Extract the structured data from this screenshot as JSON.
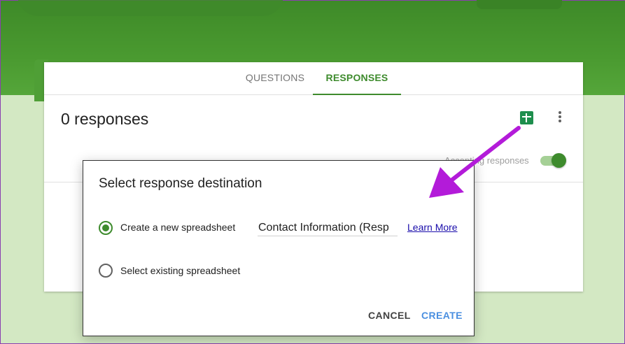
{
  "tabs": [
    {
      "label": "QUESTIONS",
      "active": false
    },
    {
      "label": "RESPONSES",
      "active": true
    }
  ],
  "responses": {
    "count_text": "0 responses",
    "accepting_label": "Accepting responses",
    "accepting": true
  },
  "dialog": {
    "title": "Select response destination",
    "options": [
      {
        "label": "Create a new spreadsheet",
        "selected": true
      },
      {
        "label": "Select existing spreadsheet",
        "selected": false
      }
    ],
    "spreadsheet_name": "Contact Information (Resp",
    "learn_more": "Learn More",
    "cancel_label": "CANCEL",
    "create_label": "CREATE"
  },
  "icons": {
    "sheets": "google-sheets-icon",
    "more": "more-vert-icon",
    "annotation": "arrow-icon"
  },
  "colors": {
    "accent": "#3e8b2d",
    "sheets": "#1e8e4d",
    "create": "#4a8fe0",
    "annotation_arrow": "#b31bd9"
  }
}
